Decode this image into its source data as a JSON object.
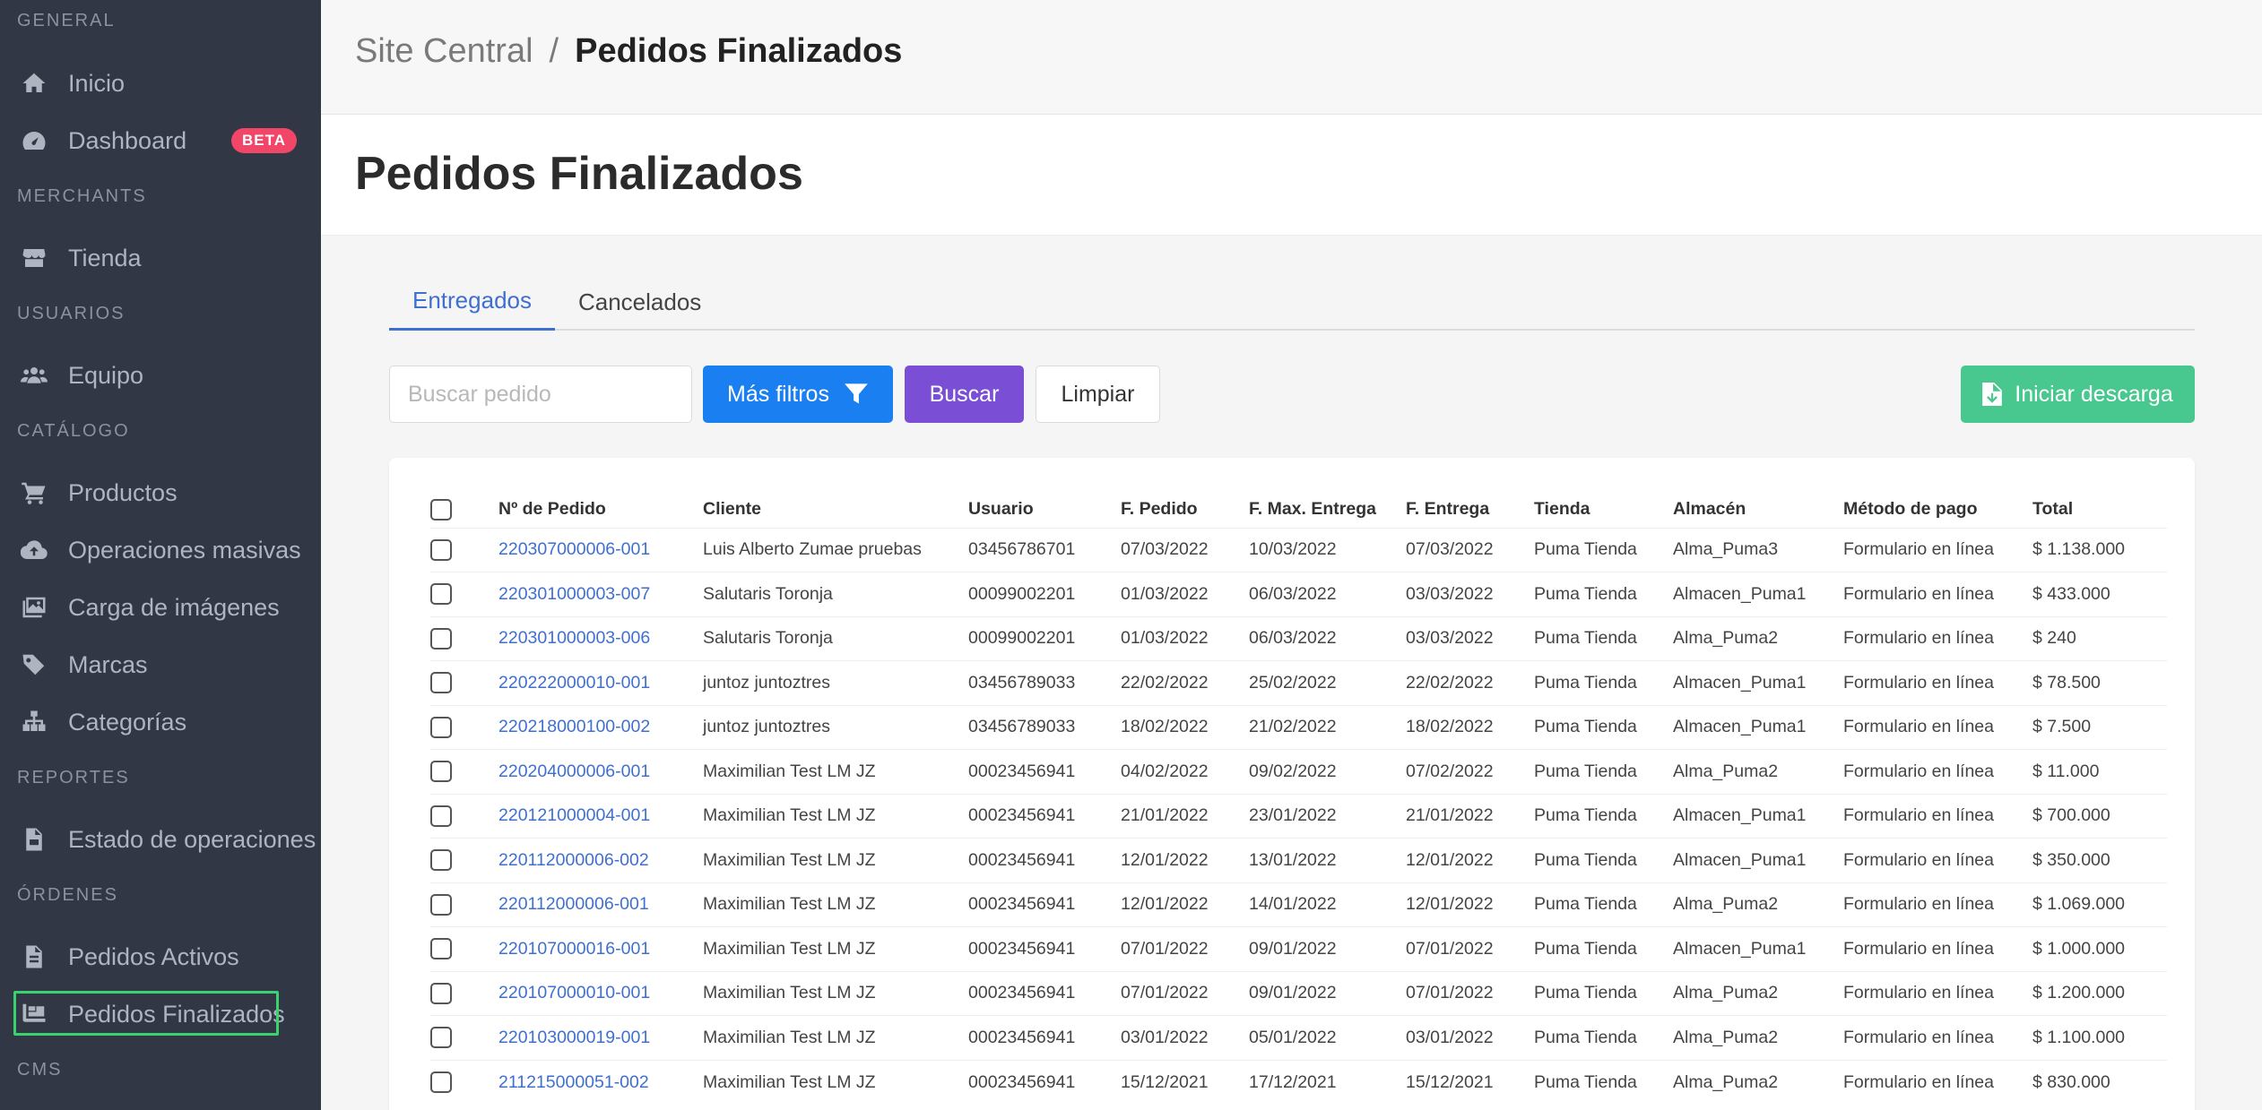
{
  "sidebar": {
    "sections": {
      "general": "GENERAL",
      "merchants": "MERCHANTS",
      "usuarios": "USUARIOS",
      "catalogo": "CATÁLOGO",
      "reportes": "REPORTES",
      "ordenes": "ÓRDENES",
      "cms": "CMS"
    },
    "items": {
      "inicio": "Inicio",
      "dashboard": "Dashboard",
      "dashboard_badge": "BETA",
      "tienda": "Tienda",
      "equipo": "Equipo",
      "productos": "Productos",
      "operaciones_masivas": "Operaciones masivas",
      "carga_imagenes": "Carga de imágenes",
      "marcas": "Marcas",
      "categorias": "Categorías",
      "estado_operaciones": "Estado de operaciones",
      "pedidos_activos": "Pedidos Activos",
      "pedidos_finalizados": "Pedidos Finalizados"
    }
  },
  "breadcrumb": {
    "root": "Site Central",
    "separator": "/",
    "current": "Pedidos Finalizados"
  },
  "page_title": "Pedidos Finalizados",
  "tabs": {
    "entregados": "Entregados",
    "cancelados": "Cancelados"
  },
  "toolbar": {
    "search_placeholder": "Buscar pedido",
    "more_filters": "Más filtros",
    "search": "Buscar",
    "clear": "Limpiar",
    "download": "Iniciar descarga"
  },
  "colors": {
    "sidebar_bg": "#313745",
    "link": "#3f6fcf",
    "primary_blue": "#1a7ff0",
    "purple": "#7a4fd6",
    "green": "#48c78e",
    "badge_red": "#f14668",
    "active_outline": "#3ad16f"
  },
  "table": {
    "headers": [
      "Nº de Pedido",
      "Cliente",
      "Usuario",
      "F. Pedido",
      "F. Max. Entrega",
      "F. Entrega",
      "Tienda",
      "Almacén",
      "Método de pago",
      "Total"
    ],
    "rows": [
      [
        "220307000006-001",
        "Luis Alberto Zumae pruebas",
        "03456786701",
        "07/03/2022",
        "10/03/2022",
        "07/03/2022",
        "Puma Tienda",
        "Alma_Puma3",
        "Formulario en línea",
        "$ 1.138.000"
      ],
      [
        "220301000003-007",
        "Salutaris Toronja",
        "00099002201",
        "01/03/2022",
        "06/03/2022",
        "03/03/2022",
        "Puma Tienda",
        "Almacen_Puma1",
        "Formulario en línea",
        "$ 433.000"
      ],
      [
        "220301000003-006",
        "Salutaris Toronja",
        "00099002201",
        "01/03/2022",
        "06/03/2022",
        "03/03/2022",
        "Puma Tienda",
        "Alma_Puma2",
        "Formulario en línea",
        "$ 240"
      ],
      [
        "220222000010-001",
        "juntoz juntoztres",
        "03456789033",
        "22/02/2022",
        "25/02/2022",
        "22/02/2022",
        "Puma Tienda",
        "Almacen_Puma1",
        "Formulario en línea",
        "$ 78.500"
      ],
      [
        "220218000100-002",
        "juntoz juntoztres",
        "03456789033",
        "18/02/2022",
        "21/02/2022",
        "18/02/2022",
        "Puma Tienda",
        "Almacen_Puma1",
        "Formulario en línea",
        "$ 7.500"
      ],
      [
        "220204000006-001",
        "Maximilian Test LM JZ",
        "00023456941",
        "04/02/2022",
        "09/02/2022",
        "07/02/2022",
        "Puma Tienda",
        "Alma_Puma2",
        "Formulario en línea",
        "$ 11.000"
      ],
      [
        "220121000004-001",
        "Maximilian Test LM JZ",
        "00023456941",
        "21/01/2022",
        "23/01/2022",
        "21/01/2022",
        "Puma Tienda",
        "Almacen_Puma1",
        "Formulario en línea",
        "$ 700.000"
      ],
      [
        "220112000006-002",
        "Maximilian Test LM JZ",
        "00023456941",
        "12/01/2022",
        "13/01/2022",
        "12/01/2022",
        "Puma Tienda",
        "Almacen_Puma1",
        "Formulario en línea",
        "$ 350.000"
      ],
      [
        "220112000006-001",
        "Maximilian Test LM JZ",
        "00023456941",
        "12/01/2022",
        "14/01/2022",
        "12/01/2022",
        "Puma Tienda",
        "Alma_Puma2",
        "Formulario en línea",
        "$ 1.069.000"
      ],
      [
        "220107000016-001",
        "Maximilian Test LM JZ",
        "00023456941",
        "07/01/2022",
        "09/01/2022",
        "07/01/2022",
        "Puma Tienda",
        "Almacen_Puma1",
        "Formulario en línea",
        "$ 1.000.000"
      ],
      [
        "220107000010-001",
        "Maximilian Test LM JZ",
        "00023456941",
        "07/01/2022",
        "09/01/2022",
        "07/01/2022",
        "Puma Tienda",
        "Alma_Puma2",
        "Formulario en línea",
        "$ 1.200.000"
      ],
      [
        "220103000019-001",
        "Maximilian Test LM JZ",
        "00023456941",
        "03/01/2022",
        "05/01/2022",
        "03/01/2022",
        "Puma Tienda",
        "Alma_Puma2",
        "Formulario en línea",
        "$ 1.100.000"
      ],
      [
        "211215000051-002",
        "Maximilian Test LM JZ",
        "00023456941",
        "15/12/2021",
        "17/12/2021",
        "15/12/2021",
        "Puma Tienda",
        "Alma_Puma2",
        "Formulario en línea",
        "$ 830.000"
      ]
    ]
  }
}
